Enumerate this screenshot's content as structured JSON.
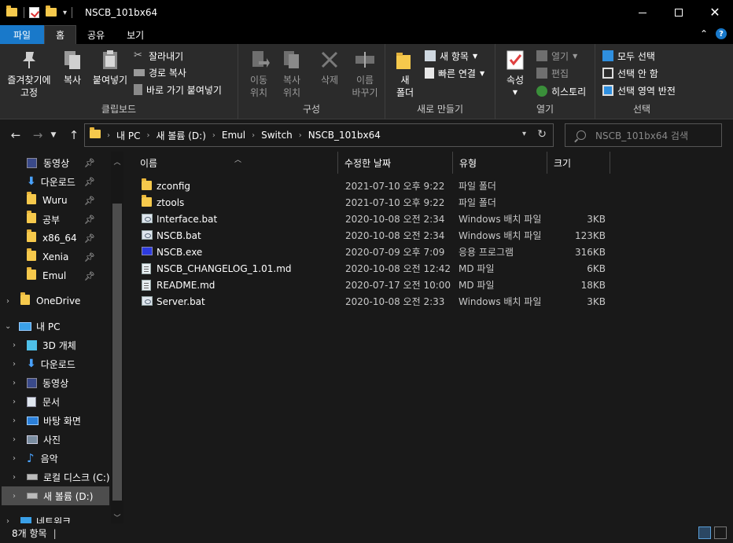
{
  "window": {
    "title": "NSCB_101bx64",
    "minimize_icon": "minimize-icon",
    "maximize_icon": "maximize-icon",
    "close_glyph": "✕"
  },
  "ribbon_tabs": [
    {
      "label": "파일"
    },
    {
      "label": "홈"
    },
    {
      "label": "공유"
    },
    {
      "label": "보기"
    }
  ],
  "ribbon": {
    "clipboard": {
      "pin_label": "즐겨찾기에\n고정",
      "copy_label": "복사",
      "paste_label": "붙여넣기",
      "cut_label": "잘라내기",
      "copy_path_label": "경로 복사",
      "paste_shortcut_label": "바로 가기 붙여넣기",
      "group_label": "클립보드"
    },
    "organize": {
      "move_label": "이동\n위치",
      "copy_to_label": "복사\n위치",
      "delete_label": "삭제",
      "rename_label": "이름\n바꾸기",
      "group_label": "구성"
    },
    "new": {
      "new_folder_label": "새\n폴더",
      "new_item_label": "새 항목",
      "easy_access_label": "빠른 연결",
      "group_label": "새로 만들기"
    },
    "open": {
      "properties_label": "속성",
      "open_label": "열기",
      "edit_label": "편집",
      "history_label": "히스토리",
      "group_label": "열기"
    },
    "select": {
      "select_all_label": "모두 선택",
      "select_none_label": "선택 안 함",
      "invert_label": "선택 영역 반전",
      "group_label": "선택"
    }
  },
  "address": {
    "crumbs": [
      "내 PC",
      "새 볼륨 (D:)",
      "Emul",
      "Switch",
      "NSCB_101bx64"
    ],
    "search_placeholder": "NSCB_101bx64 검색"
  },
  "nav_pane": {
    "quick_access": [
      {
        "label": "동영상",
        "icon": "video-icon"
      },
      {
        "label": "다운로드",
        "icon": "download-icon"
      },
      {
        "label": "Wuru",
        "icon": "folder-icon"
      },
      {
        "label": "공부",
        "icon": "folder-icon"
      },
      {
        "label": "x86_64",
        "icon": "folder-icon"
      },
      {
        "label": "Xenia",
        "icon": "folder-icon"
      },
      {
        "label": "Emul",
        "icon": "folder-icon"
      }
    ],
    "onedrive": "OneDrive",
    "this_pc": "내 PC",
    "pc_items": [
      {
        "label": "3D 개체",
        "icon": "cube-icon"
      },
      {
        "label": "다운로드",
        "icon": "download-icon"
      },
      {
        "label": "동영상",
        "icon": "video-icon"
      },
      {
        "label": "문서",
        "icon": "document-icon"
      },
      {
        "label": "바탕 화면",
        "icon": "desktop-icon"
      },
      {
        "label": "사진",
        "icon": "picture-icon"
      },
      {
        "label": "음악",
        "icon": "music-icon"
      },
      {
        "label": "로컬 디스크 (C:)",
        "icon": "drive-icon"
      },
      {
        "label": "새 볼륨 (D:)",
        "icon": "drive-icon"
      }
    ],
    "network": "네트워크"
  },
  "columns": {
    "name": "이름",
    "date": "수정한 날짜",
    "type": "유형",
    "size": "크기"
  },
  "files": [
    {
      "name": "zconfig",
      "date": "2021-07-10 오후 9:22",
      "type": "파일 폴더",
      "size": "",
      "icon": "folder"
    },
    {
      "name": "ztools",
      "date": "2021-07-10 오후 9:22",
      "type": "파일 폴더",
      "size": "",
      "icon": "folder"
    },
    {
      "name": "Interface.bat",
      "date": "2020-10-08 오전 2:34",
      "type": "Windows 배치 파일",
      "size": "3KB",
      "icon": "bat"
    },
    {
      "name": "NSCB.bat",
      "date": "2020-10-08 오전 2:34",
      "type": "Windows 배치 파일",
      "size": "123KB",
      "icon": "bat"
    },
    {
      "name": "NSCB.exe",
      "date": "2020-07-09 오후 7:09",
      "type": "응용 프로그램",
      "size": "316KB",
      "icon": "exe"
    },
    {
      "name": "NSCB_CHANGELOG_1.01.md",
      "date": "2020-10-08 오전 12:42",
      "type": "MD 파일",
      "size": "6KB",
      "icon": "md"
    },
    {
      "name": "README.md",
      "date": "2020-07-17 오전 10:00",
      "type": "MD 파일",
      "size": "18KB",
      "icon": "md"
    },
    {
      "name": "Server.bat",
      "date": "2020-10-08 오전 2:33",
      "type": "Windows 배치 파일",
      "size": "3KB",
      "icon": "bat"
    }
  ],
  "status": {
    "count": "8개 항목",
    "separator": "|"
  },
  "colors": {
    "accent": "#1979ca",
    "folder": "#f6c94c",
    "background": "#191919"
  }
}
